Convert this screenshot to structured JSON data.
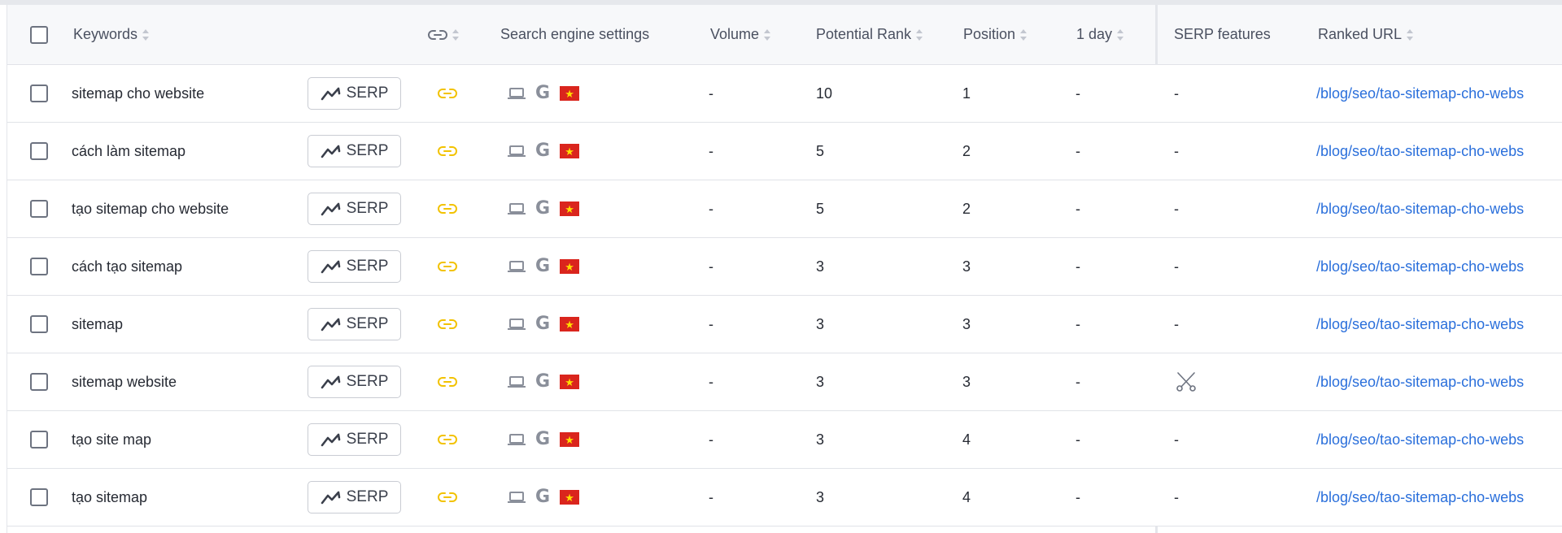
{
  "header": {
    "keywords": "Keywords",
    "link_icon": "link-icon",
    "search_engine_settings": "Search engine settings",
    "volume": "Volume",
    "potential_rank": "Potential Rank",
    "position": "Position",
    "one_day": "1 day",
    "serp_features": "SERP features",
    "ranked_url": "Ranked URL"
  },
  "serp_button_label": "SERP",
  "engine": {
    "device_icon": "laptop-icon",
    "search_engine": "G",
    "country_flag": "vietnam-flag",
    "flag_star": "★"
  },
  "colors": {
    "link_icon": "#f2c200",
    "url": "#2a6fdb",
    "flag_red": "#da251d",
    "flag_star": "#ffde00"
  },
  "rows": [
    {
      "keyword": "sitemap cho website",
      "volume": "-",
      "potential_rank": "10",
      "position": "1",
      "one_day": "-",
      "serp_features": "-",
      "ranked_url": "/blog/seo/tao-sitemap-cho-webs"
    },
    {
      "keyword": "cách làm sitemap",
      "volume": "-",
      "potential_rank": "5",
      "position": "2",
      "one_day": "-",
      "serp_features": "-",
      "ranked_url": "/blog/seo/tao-sitemap-cho-webs"
    },
    {
      "keyword": "tạo sitemap cho website",
      "volume": "-",
      "potential_rank": "5",
      "position": "2",
      "one_day": "-",
      "serp_features": "-",
      "ranked_url": "/blog/seo/tao-sitemap-cho-webs"
    },
    {
      "keyword": "cách tạo sitemap",
      "volume": "-",
      "potential_rank": "3",
      "position": "3",
      "one_day": "-",
      "serp_features": "-",
      "ranked_url": "/blog/seo/tao-sitemap-cho-webs"
    },
    {
      "keyword": "sitemap",
      "volume": "-",
      "potential_rank": "3",
      "position": "3",
      "one_day": "-",
      "serp_features": "-",
      "ranked_url": "/blog/seo/tao-sitemap-cho-webs"
    },
    {
      "keyword": "sitemap website",
      "volume": "-",
      "potential_rank": "3",
      "position": "3",
      "one_day": "-",
      "serp_features": "scissors-icon",
      "ranked_url": "/blog/seo/tao-sitemap-cho-webs"
    },
    {
      "keyword": "tạo site map",
      "volume": "-",
      "potential_rank": "3",
      "position": "4",
      "one_day": "-",
      "serp_features": "-",
      "ranked_url": "/blog/seo/tao-sitemap-cho-webs"
    },
    {
      "keyword": "tạo sitemap",
      "volume": "-",
      "potential_rank": "3",
      "position": "4",
      "one_day": "-",
      "serp_features": "-",
      "ranked_url": "/blog/seo/tao-sitemap-cho-webs"
    }
  ]
}
